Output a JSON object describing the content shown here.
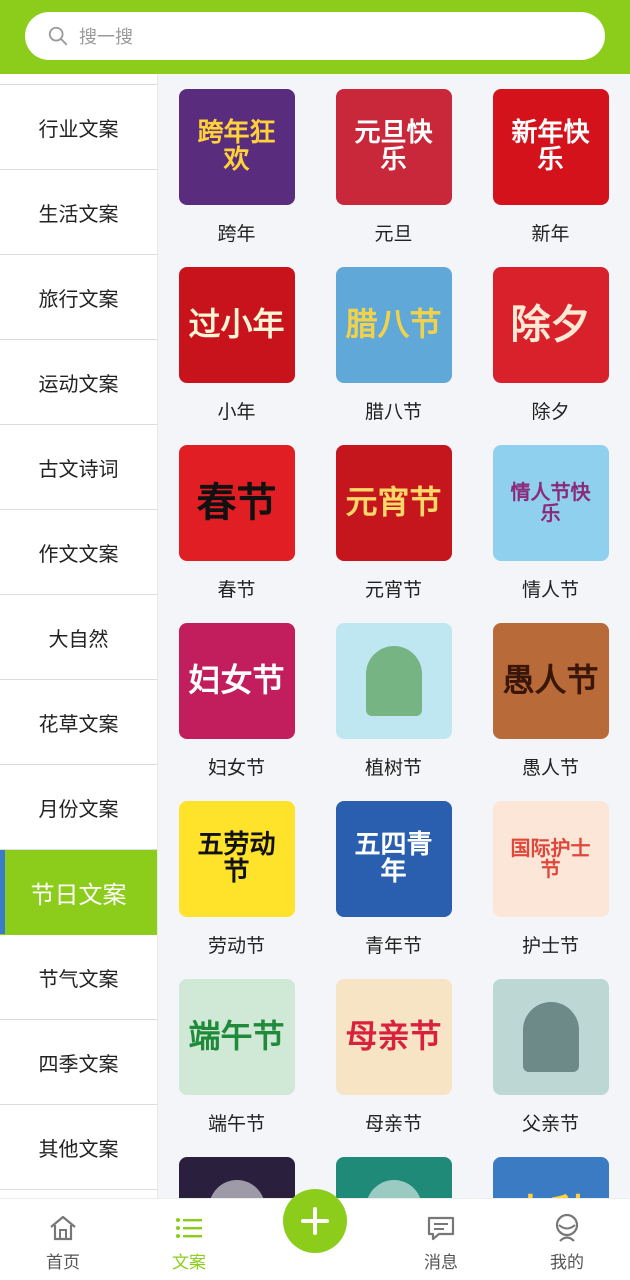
{
  "search": {
    "placeholder": "搜一搜"
  },
  "sidebar": {
    "items": [
      {
        "label": "行业文案"
      },
      {
        "label": "生活文案"
      },
      {
        "label": "旅行文案"
      },
      {
        "label": "运动文案"
      },
      {
        "label": "古文诗词"
      },
      {
        "label": "作文文案"
      },
      {
        "label": "大自然"
      },
      {
        "label": "花草文案"
      },
      {
        "label": "月份文案"
      },
      {
        "label": "节日文案",
        "active": true
      },
      {
        "label": "节气文案"
      },
      {
        "label": "四季文案"
      },
      {
        "label": "其他文案"
      }
    ]
  },
  "grid": {
    "items": [
      {
        "label": "跨年",
        "art": "跨年狂欢",
        "bg": "#5a2c7e",
        "fg": "#ffd23a"
      },
      {
        "label": "元旦",
        "art": "元旦快乐",
        "bg": "#c8283a",
        "fg": "#ffffff"
      },
      {
        "label": "新年",
        "art": "新年快乐",
        "bg": "#d4121c",
        "fg": "#ffffff"
      },
      {
        "label": "小年",
        "art": "过小年",
        "bg": "#c8121c",
        "fg": "#fff4d4"
      },
      {
        "label": "腊八节",
        "art": "腊八节",
        "bg": "#5fa8d8",
        "fg": "#f2d24a"
      },
      {
        "label": "除夕",
        "art": "除夕",
        "bg": "#d8212b",
        "fg": "#ffe9d4"
      },
      {
        "label": "春节",
        "art": "春节",
        "bg": "#e01e24",
        "fg": "#111111"
      },
      {
        "label": "元宵节",
        "art": "元宵节",
        "bg": "#c4161c",
        "fg": "#ffd86a"
      },
      {
        "label": "情人节",
        "art": "情人节快乐",
        "bg": "#8fd0ee",
        "fg": "#8b2a7a"
      },
      {
        "label": "妇女节",
        "art": "妇女节",
        "bg": "#c21d5c",
        "fg": "#ffffff"
      },
      {
        "label": "植树节",
        "art": "",
        "bg": "#bfe7f2",
        "fg": "#3a8a2a"
      },
      {
        "label": "愚人节",
        "art": "愚人节",
        "bg": "#b86a38",
        "fg": "#3a1608"
      },
      {
        "label": "劳动节",
        "art": "五劳动节",
        "bg": "#ffe22a",
        "fg": "#111111"
      },
      {
        "label": "青年节",
        "art": "五四青年",
        "bg": "#2a5fb0",
        "fg": "#ffffff"
      },
      {
        "label": "护士节",
        "art": "国际护士节",
        "bg": "#fbe6d8",
        "fg": "#e0473a"
      },
      {
        "label": "端午节",
        "art": "端午节",
        "bg": "#cfe9d6",
        "fg": "#1f8a3a"
      },
      {
        "label": "母亲节",
        "art": "母亲节",
        "bg": "#f6e4c4",
        "fg": "#d8213b"
      },
      {
        "label": "父亲节",
        "art": "",
        "bg": "#bcd7d4",
        "fg": "#2e4b48"
      },
      {
        "label": "",
        "art": "",
        "bg": "#2a1f3d",
        "fg": "#ffffff"
      },
      {
        "label": "",
        "art": "",
        "bg": "#1f8a78",
        "fg": "#ffffff"
      },
      {
        "label": "",
        "art": "中秋",
        "bg": "#3a7bc4",
        "fg": "#ffd23a"
      }
    ]
  },
  "bottom_nav": {
    "home": "首页",
    "copy": "文案",
    "messages": "消息",
    "mine": "我的"
  },
  "colors": {
    "accent": "#8ccd1b",
    "active_marker": "#3a7cc7"
  }
}
